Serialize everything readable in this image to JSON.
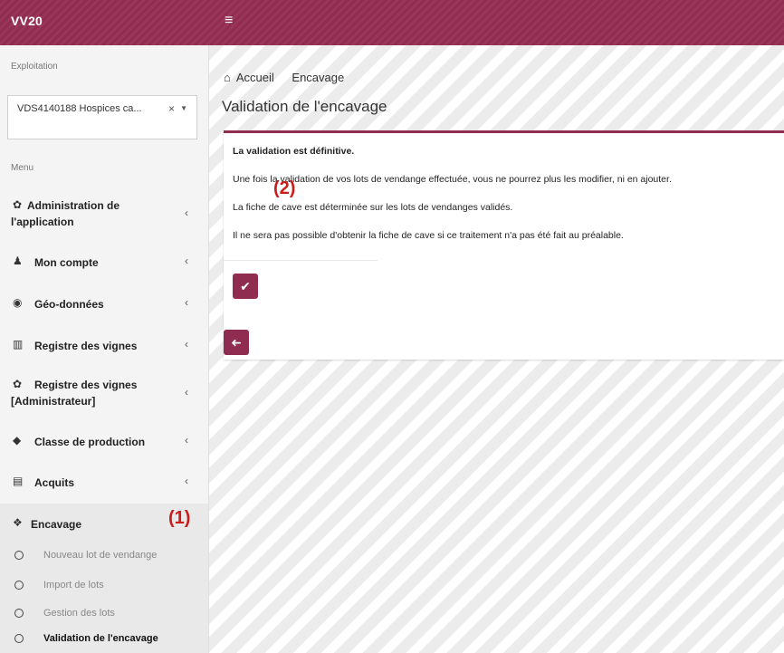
{
  "app": {
    "brand": "VV20",
    "menu_toggle_icon": "hamburger-icon"
  },
  "sidebar": {
    "exploitation_label": "Exploitation",
    "exploitation_select": {
      "value": "VDS4140188 Hospices ca...",
      "clear": "×",
      "caret": "▼"
    },
    "menu_label": "Menu",
    "items": [
      {
        "icon": "gear-icon",
        "glyph": "✿",
        "label_line1": "Administration de",
        "label_line2": "l'application",
        "chevron": "‹"
      },
      {
        "icon": "user-icon",
        "glyph": "♟",
        "label_line1": "Mon compte",
        "chevron": "‹"
      },
      {
        "icon": "globe-icon",
        "glyph": "◉",
        "label_line1": "Géo-données",
        "chevron": "‹"
      },
      {
        "icon": "map-icon",
        "glyph": "▥",
        "label_line1": "Registre des vignes",
        "chevron": "‹"
      },
      {
        "icon": "gear-icon",
        "glyph": "✿",
        "label_line1": "Registre des vignes",
        "label_line2": "[Administrateur]",
        "chevron": "‹"
      },
      {
        "icon": "tag-icon",
        "glyph": "◆",
        "label_line1": "Classe de production",
        "chevron": "‹"
      },
      {
        "icon": "file-icon",
        "glyph": "▤",
        "label_line1": "Acquits",
        "chevron": "‹"
      },
      {
        "icon": "cubes-icon",
        "glyph": "❖",
        "label_line1": "Encavage"
      }
    ],
    "subitems": [
      {
        "label": "Nouveau lot de vendange"
      },
      {
        "label": "Import de lots"
      },
      {
        "label": "Gestion des lots"
      },
      {
        "label": "Validation de l'encavage"
      }
    ]
  },
  "callouts": {
    "one": "(1)",
    "two": "(2)"
  },
  "main": {
    "breadcrumb": {
      "home_icon": "home-icon",
      "home_glyph": "⌂",
      "home": "Accueil",
      "current": "Encavage"
    },
    "title": "Validation de l'encavage",
    "panel": {
      "line1": "La validation est définitive.",
      "line2": "Une fois la validation de vos lots de vendange effectuée, vous ne pourrez plus les modifier, ni en ajouter.",
      "line3": "La fiche de cave est déterminée sur les lots de vendanges validés.",
      "line4": "Il ne sera pas possible d'obtenir la fiche de cave si ce traitement n'a pas été fait au préalable."
    },
    "buttons": {
      "validate_glyph": "✔",
      "back_glyph": "➜"
    }
  },
  "colors": {
    "brand": "#8f2c4f",
    "callout": "#cc1b1b"
  }
}
